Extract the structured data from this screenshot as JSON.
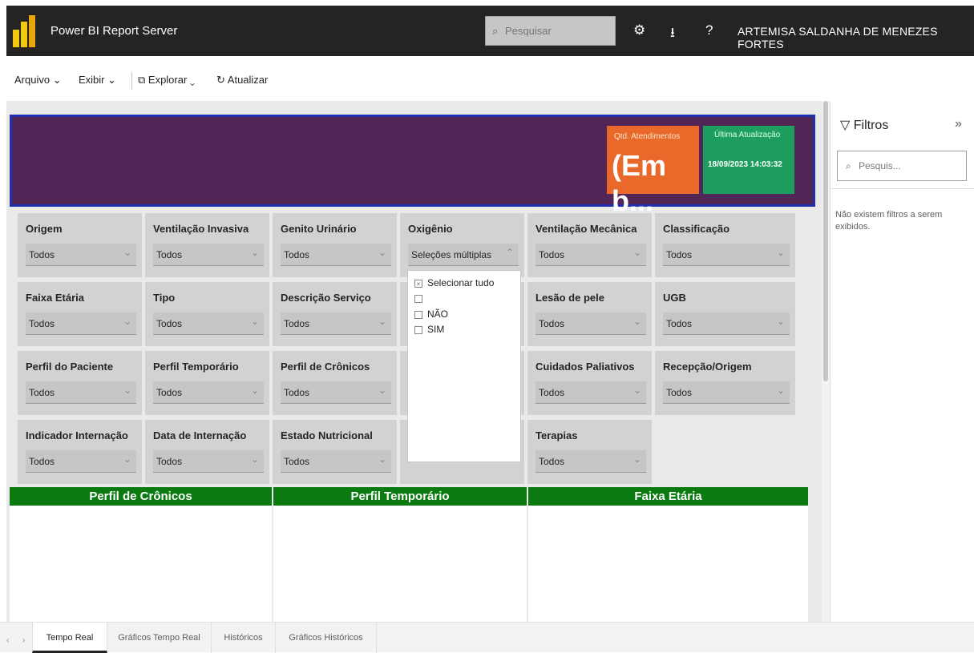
{
  "topbar": {
    "app_title": "Power BI Report Server",
    "search_placeholder": "Pesquisar",
    "search_glyph": "⌕",
    "settings_glyph": "⚙",
    "download_glyph": "⭳",
    "help_glyph": "?",
    "user_name": "ARTEMISA SALDANHA DE MENEZES FORTES"
  },
  "toolbar": {
    "arquivo": "Arquivo ⌄",
    "exibir": "Exibir ⌄",
    "explorar": "⧉ Explorar ⌄",
    "atualizar": "↻ Atualizar"
  },
  "cards": {
    "qtd_title": "Qtd. Atendimentos",
    "qtd_value": "(Em b...",
    "upd_title": "Última Atualização",
    "upd_value": "18/09/2023 14:03:32"
  },
  "slicer_chevron": "⌄",
  "slicer_chevron_open": "⌃",
  "slicers": {
    "origem": {
      "label": "Origem",
      "value": "Todos"
    },
    "ventilacao_invasiva": {
      "label": "Ventilação Invasiva",
      "value": "Todos"
    },
    "genito_urinario": {
      "label": "Genito Urinário",
      "value": "Todos"
    },
    "oxigenio": {
      "label": "Oxigênio",
      "value": "Seleções múltiplas"
    },
    "ventilacao_mecanica": {
      "label": "Ventilação Mecânica",
      "value": "Todos"
    },
    "classificacao": {
      "label": "Classificação",
      "value": "Todos"
    },
    "faixa_etaria": {
      "label": "Faixa Etária",
      "value": "Todos"
    },
    "tipo": {
      "label": "Tipo",
      "value": "Todos"
    },
    "descricao_servico": {
      "label": "Descrição Serviço",
      "value": "Todos"
    },
    "lesao_pele": {
      "label": "Lesão de pele",
      "value": "Todos"
    },
    "ugb": {
      "label": "UGB",
      "value": "Todos"
    },
    "perfil_paciente": {
      "label": "Perfil do Paciente",
      "value": "Todos"
    },
    "perfil_temporario": {
      "label": "Perfil Temporário",
      "value": "Todos"
    },
    "perfil_cronicos": {
      "label": "Perfil de Crônicos",
      "value": "Todos"
    },
    "cuidados_paliativos": {
      "label": "Cuidados Paliativos",
      "value": "Todos"
    },
    "recepcao_origem": {
      "label": "Recepção/Origem",
      "value": "Todos"
    },
    "indicador_internacao": {
      "label": "Indicador Internação",
      "value": "Todos"
    },
    "data_internacao": {
      "label": "Data de Internação",
      "value": "Todos"
    },
    "estado_nutricional": {
      "label": "Estado Nutricional",
      "value": "Todos"
    },
    "terapias": {
      "label": "Terapias",
      "value": "Todos"
    }
  },
  "oxigenio_popup": {
    "select_all": "Selecionar tudo",
    "select_all_mark": "×",
    "blank": "",
    "nao": "NÃO",
    "sim": "SIM"
  },
  "sections": {
    "cronicos": "Perfil de Crônicos",
    "temporario": "Perfil Temporário",
    "faixa": "Faixa Etária"
  },
  "filters": {
    "title": "Filtros",
    "funnel_glyph": "▽",
    "collapse_glyph": "»",
    "search_placeholder": "Pesquis...",
    "empty_text": "Não existem filtros a serem exibidos."
  },
  "tabs": {
    "prev": "‹",
    "next": "›",
    "items": [
      "Tempo Real",
      "Gráficos Tempo Real",
      "Históricos",
      "Gráficos Históricos"
    ]
  }
}
